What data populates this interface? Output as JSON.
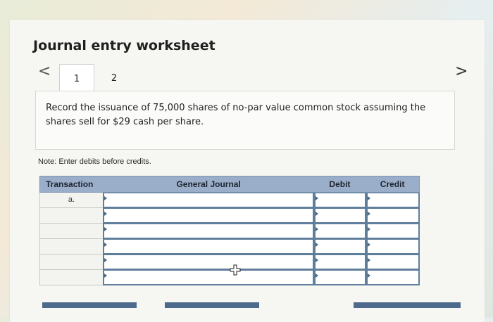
{
  "worksheet": {
    "title": "Journal entry worksheet",
    "tabs": [
      {
        "label": "1"
      },
      {
        "label": "2"
      }
    ],
    "prev_symbol": "<",
    "next_symbol": ">"
  },
  "question": {
    "text": "Record the issuance of 75,000 shares of no-par value common stock assuming the shares sell for $29 cash per share."
  },
  "note": "Note: Enter debits before credits.",
  "journal": {
    "headers": {
      "transaction": "Transaction",
      "general_journal": "General Journal",
      "debit": "Debit",
      "credit": "Credit"
    },
    "rows": [
      {
        "transaction": "a."
      },
      {
        "transaction": ""
      },
      {
        "transaction": ""
      },
      {
        "transaction": ""
      },
      {
        "transaction": ""
      },
      {
        "transaction": ""
      }
    ]
  },
  "colors": {
    "header_bg": "#9aaec9",
    "input_border": "#5f7e9c",
    "button": "#4d6a8c"
  }
}
